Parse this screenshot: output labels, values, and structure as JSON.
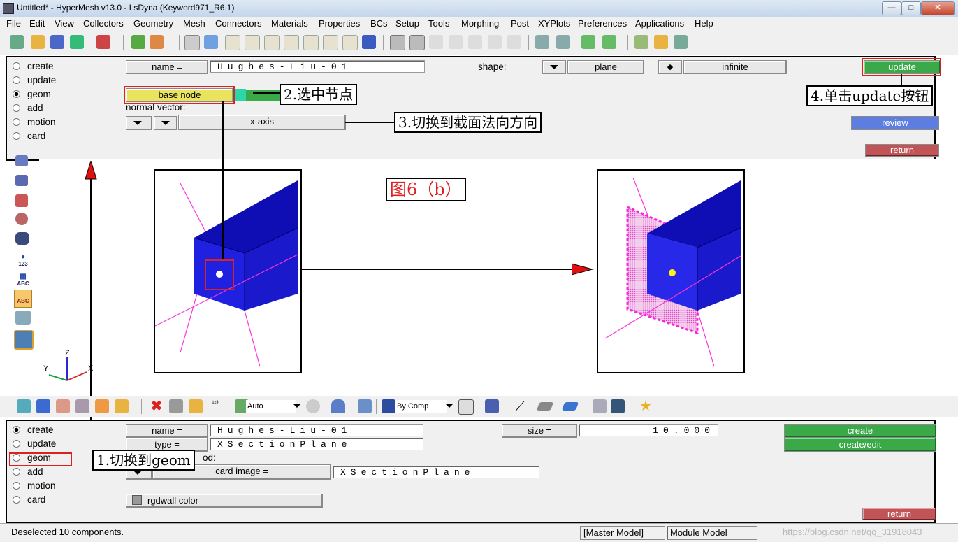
{
  "window": {
    "title": "Untitled* - HyperMesh v13.0 - LsDyna (Keyword971_R6.1)",
    "controls": {
      "minimize": "—",
      "maximize": "□",
      "close": "✕"
    }
  },
  "menu": [
    "File",
    "Edit",
    "View",
    "Collectors",
    "Geometry",
    "Mesh",
    "Connectors",
    "Materials",
    "Properties",
    "BCs",
    "Setup",
    "Tools",
    "Morphing",
    "Post",
    "XYPlots",
    "Preferences",
    "Applications",
    "Help"
  ],
  "top_panel": {
    "radios": [
      {
        "label": "create",
        "selected": false
      },
      {
        "label": "update",
        "selected": false
      },
      {
        "label": "geom",
        "selected": true
      },
      {
        "label": "add",
        "selected": false
      },
      {
        "label": "motion",
        "selected": false
      },
      {
        "label": "card",
        "selected": false
      }
    ],
    "name_label": "name =",
    "name_value": "Hughes-Liu-01",
    "shape_label": "shape:",
    "shape_value": "plane",
    "extent_value": "infinite",
    "base_node_label": "base node",
    "normal_vector_label": "normal vector:",
    "axis_value": "x-axis",
    "update_label": "update",
    "review_label": "review",
    "return_label": "return"
  },
  "annotations": {
    "step1": "1.切换到geom",
    "step2": "2.选中节点",
    "step3": "3.切换到截面法向方向",
    "step4": "4.单击update按钮",
    "figure_label": "图6（b）"
  },
  "axes": {
    "z": "Z",
    "y": "Y",
    "x": "X"
  },
  "left_icon_labels": {
    "num": "123",
    "abc": "ABC",
    "abc2": "ABC"
  },
  "toolbar2": {
    "auto_label": "Auto",
    "bycomp_label": "By Comp"
  },
  "bottom_panel": {
    "radios": [
      {
        "label": "create",
        "selected": true
      },
      {
        "label": "update",
        "selected": false
      },
      {
        "label": "geom",
        "selected": false
      },
      {
        "label": "add",
        "selected": false
      },
      {
        "label": "motion",
        "selected": false
      },
      {
        "label": "card",
        "selected": false
      }
    ],
    "name_label": "name =",
    "name_value": "Hughes-Liu-01",
    "type_label": "type =",
    "type_value": "XSectionPlane",
    "method_fragment": "od:",
    "card_image_label": "card image =",
    "card_image_value": "XSectionPlane",
    "size_label": "size =",
    "size_value": "10.000",
    "create_label": "create",
    "create_edit_label": "create/edit",
    "color_label": "rgdwall color",
    "return_label": "return"
  },
  "status": {
    "message": "Deselected 10 components.",
    "model1": "[Master Model]",
    "model2": "Module Model",
    "watermark": "https://blog.csdn.net/qq_31918043"
  },
  "colors": {
    "panel_bg": "#f0f0f0",
    "green_button": "#3aaa48",
    "blue_button": "#5e7de0",
    "red_button": "#c05456",
    "highlight_red": "#e02020",
    "part_blue": "#1a1ad6",
    "plane_magenta": "#ff33dd"
  }
}
